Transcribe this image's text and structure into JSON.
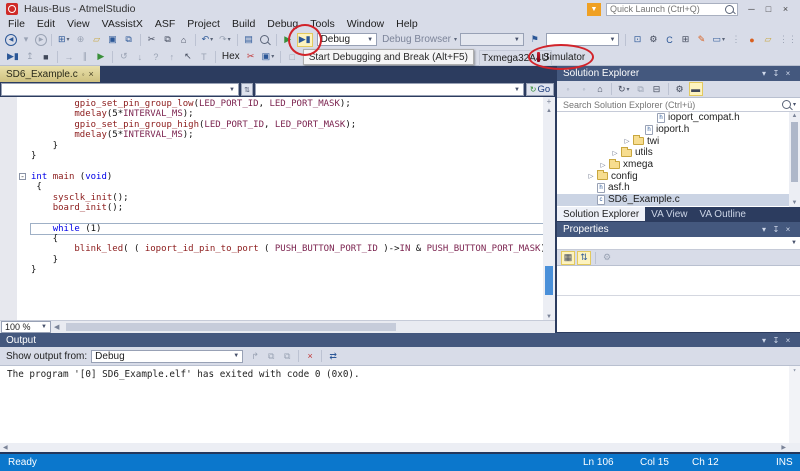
{
  "titlebar": {
    "title": "Haus-Bus - AtmelStudio",
    "quick_launch_placeholder": "Quick Launch (Ctrl+Q)",
    "window_buttons": [
      {
        "n": "minimize-button",
        "g": "─"
      },
      {
        "n": "maximize-button",
        "g": "□"
      },
      {
        "n": "close-button",
        "g": "×"
      }
    ]
  },
  "menubar": {
    "items": [
      "File",
      "Edit",
      "View",
      "VAssistX",
      "ASF",
      "Project",
      "Build",
      "Debug",
      "Tools",
      "Window",
      "Help"
    ]
  },
  "toolbar1": {
    "left_icons": [
      {
        "n": "navigate-backward-icon",
        "g": "◀",
        "c": "blue",
        "circ": true
      },
      {
        "n": "navigate-back-dropdown-icon",
        "g": "▾",
        "c": "dim"
      },
      {
        "n": "navigate-forward-icon",
        "g": "▶",
        "c": "dim",
        "circ": true
      },
      {
        "sep": true
      },
      {
        "n": "new-project-icon",
        "g": "⊞",
        "c": "blue",
        "dd": true
      },
      {
        "n": "add-new-item-icon",
        "g": "⊕",
        "c": "dim"
      },
      {
        "n": "open-file-icon",
        "g": "▱",
        "c": "yellow"
      },
      {
        "n": "save-icon",
        "g": "▣",
        "c": "blue"
      },
      {
        "n": "save-all-icon",
        "g": "⧉",
        "c": "blue"
      },
      {
        "sep": true
      },
      {
        "n": "cut-icon",
        "g": "✂",
        "c": "dark"
      },
      {
        "n": "copy-icon",
        "g": "⧉",
        "c": "dark"
      },
      {
        "n": "paste-icon",
        "g": "⌂",
        "c": "dark"
      },
      {
        "sep": true
      },
      {
        "n": "undo-icon",
        "g": "↶",
        "c": "blue",
        "dd": true
      },
      {
        "n": "redo-icon",
        "g": "↷",
        "c": "dim",
        "dd": true
      },
      {
        "sep": true
      },
      {
        "n": "solution-configurations-icon",
        "g": "▤",
        "c": "blue"
      },
      {
        "n": "find-icon",
        "mag": true
      },
      {
        "sep": true
      },
      {
        "n": "run-icon",
        "g": "▶",
        "c": "green"
      },
      {
        "n": "start-debug-break-icon",
        "g": "▶▮",
        "c": "blue",
        "hl": true
      }
    ],
    "debug_combo": "Debug",
    "debug_browser_label": "Debug Browser",
    "right_icons": [
      {
        "n": "bookmark-flag-icon",
        "g": "⚑",
        "c": "blue"
      }
    ],
    "far_icons": [
      {
        "sep": true
      },
      {
        "n": "switch-windows-icon",
        "g": "⊡",
        "c": "blue"
      },
      {
        "n": "tools-wrench-icon",
        "g": "⚙",
        "c": "dark"
      },
      {
        "n": "refresh-device-icon",
        "g": "C",
        "c": "blue"
      },
      {
        "n": "package-icon",
        "g": "⊞",
        "c": "dark"
      },
      {
        "n": "format-paint-icon",
        "g": "✎",
        "c": "orange"
      },
      {
        "n": "device-programming-icon",
        "g": "▭",
        "c": "blue",
        "dd": true
      },
      {
        "n": "overflow-icon",
        "g": "⋮",
        "c": "dim"
      },
      {
        "n": "asf-wizard-icon",
        "g": "●",
        "c": "orange"
      },
      {
        "n": "import-folder-icon",
        "g": "▱",
        "c": "yellow"
      },
      {
        "n": "overflow2-icon",
        "g": "⋮⋮",
        "c": "dim"
      }
    ]
  },
  "toolbar2": {
    "icons": [
      {
        "n": "restart-debug-icon",
        "g": "▶▮",
        "c": "blue"
      },
      {
        "n": "show-next-statement-icon",
        "g": "↥",
        "c": "dim"
      },
      {
        "n": "stop-debug-icon",
        "g": "■",
        "c": "dark"
      },
      {
        "sep": true
      },
      {
        "n": "step-over-icon",
        "g": "→",
        "c": "dim"
      },
      {
        "n": "break-all-icon",
        "g": "∥",
        "c": "dim"
      },
      {
        "n": "continue-icon",
        "g": "▶",
        "c": "green"
      },
      {
        "sep": true
      },
      {
        "n": "reset-icon",
        "g": "↺",
        "c": "dim"
      },
      {
        "n": "step-into-icon",
        "g": "↓",
        "c": "dim"
      },
      {
        "n": "quick-watch-icon",
        "g": "?",
        "c": "dim"
      },
      {
        "n": "step-out-icon",
        "g": "↑",
        "c": "dim"
      },
      {
        "n": "run-to-cursor-icon",
        "g": "↖",
        "c": "dark"
      },
      {
        "n": "toggle-tool-icon",
        "g": "T",
        "c": "dim"
      },
      {
        "sep": true
      }
    ],
    "hex_label": "Hex",
    "icons2": [
      {
        "n": "delete-breakpoints-icon",
        "g": "✂",
        "c": "red"
      },
      {
        "n": "watch-window-icon",
        "g": "▣",
        "c": "blue",
        "dd": true
      },
      {
        "sep": true
      },
      {
        "n": "disabled-tool-1-icon",
        "g": "□",
        "c": "dim"
      },
      {
        "n": "disabled-tool-2-icon",
        "g": "□",
        "c": "dim"
      }
    ],
    "tooltip": "Start Debugging and Break (Alt+F5)",
    "device_label": "Txmega32A4U",
    "simulator_label": "Simulator"
  },
  "editor": {
    "tab_title": "SD6_Example.c",
    "go_button": "Go",
    "zoom_level": "100 %",
    "code_lines": [
      {
        "segs": [
          [
            "pl",
            "        "
          ],
          [
            "fn",
            "gpio_set_pin_group_low"
          ],
          [
            "pl",
            "("
          ],
          [
            "mc",
            "LED_PORT_ID"
          ],
          [
            "pl",
            ", "
          ],
          [
            "mc",
            "LED_PORT_MASK"
          ],
          [
            "pl",
            ");"
          ]
        ]
      },
      {
        "segs": [
          [
            "pl",
            "        "
          ],
          [
            "fn",
            "mdelay"
          ],
          [
            "pl",
            "(5*"
          ],
          [
            "mc",
            "INTERVAL_MS"
          ],
          [
            "pl",
            ");"
          ]
        ]
      },
      {
        "segs": [
          [
            "pl",
            "        "
          ],
          [
            "fn",
            "gpio_set_pin_group_high"
          ],
          [
            "pl",
            "("
          ],
          [
            "mc",
            "LED_PORT_ID"
          ],
          [
            "pl",
            ", "
          ],
          [
            "mc",
            "LED_PORT_MASK"
          ],
          [
            "pl",
            ");"
          ]
        ]
      },
      {
        "segs": [
          [
            "pl",
            "        "
          ],
          [
            "fn",
            "mdelay"
          ],
          [
            "pl",
            "(5*"
          ],
          [
            "mc",
            "INTERVAL_MS"
          ],
          [
            "pl",
            ");"
          ]
        ]
      },
      {
        "segs": [
          [
            "pl",
            "    }"
          ]
        ]
      },
      {
        "segs": [
          [
            "pl",
            "}"
          ]
        ]
      },
      {
        "segs": []
      },
      {
        "fold": true,
        "segs": [
          [
            "kw",
            "int"
          ],
          [
            "pl",
            " "
          ],
          [
            "fn",
            "main"
          ],
          [
            "pl",
            " ("
          ],
          [
            "kw",
            "void"
          ],
          [
            "pl",
            ")"
          ]
        ]
      },
      {
        "segs": [
          [
            "pl",
            " {"
          ]
        ]
      },
      {
        "segs": [
          [
            "pl",
            "    "
          ],
          [
            "fn",
            "sysclk_init"
          ],
          [
            "pl",
            "();"
          ]
        ]
      },
      {
        "segs": [
          [
            "pl",
            "    "
          ],
          [
            "fn",
            "board_init"
          ],
          [
            "pl",
            "();"
          ]
        ]
      },
      {
        "segs": []
      },
      {
        "current": true,
        "segs": [
          [
            "pl",
            "    "
          ],
          [
            "kw",
            "while"
          ],
          [
            "pl",
            " (1)"
          ]
        ]
      },
      {
        "segs": [
          [
            "pl",
            "    {"
          ]
        ]
      },
      {
        "segs": [
          [
            "pl",
            "        "
          ],
          [
            "fn",
            "blink_led"
          ],
          [
            "pl",
            "( ( "
          ],
          [
            "fn",
            "ioport_id_pin_to_port"
          ],
          [
            "pl",
            " ( "
          ],
          [
            "mc",
            "PUSH_BUTTON_PORT_ID"
          ],
          [
            "pl",
            " )->"
          ],
          [
            "mc",
            "IN"
          ],
          [
            "pl",
            " & "
          ],
          [
            "mc",
            "PUSH_BUTTON_PORT_MASK"
          ],
          [
            "pl",
            ")^"
          ],
          [
            "mc",
            "PUSH_BUTTON_PORT_MASK"
          ],
          [
            "pl",
            " );"
          ]
        ]
      },
      {
        "segs": [
          [
            "pl",
            "    }"
          ]
        ]
      },
      {
        "segs": [
          [
            "pl",
            "}"
          ]
        ]
      }
    ]
  },
  "solution_explorer": {
    "title": "Solution Explorer",
    "search_placeholder": "Search Solution Explorer (Ctrl+ü)",
    "toolbar_icons": [
      {
        "n": "se-back-icon",
        "g": "◦",
        "c": "dim"
      },
      {
        "n": "se-forward-icon",
        "g": "◦",
        "c": "dim"
      },
      {
        "n": "se-home-icon",
        "g": "⌂",
        "c": "dark"
      },
      {
        "sep": true
      },
      {
        "n": "pending-changes-icon",
        "g": "↻",
        "c": "dark",
        "dd": true
      },
      {
        "n": "sync-with-active-document-icon",
        "g": "⧉",
        "c": "dim"
      },
      {
        "n": "collapse-all-icon",
        "g": "⊟",
        "c": "dark"
      },
      {
        "sep": true
      },
      {
        "n": "se-properties-icon",
        "g": "⚙",
        "c": "dark"
      },
      {
        "n": "preview-selected-icon",
        "g": "▬",
        "c": "dark",
        "hl": true
      }
    ],
    "tree": [
      {
        "label": "ioport_compat.h",
        "icon": "header-file",
        "level": 5,
        "expander": false
      },
      {
        "label": "ioport.h",
        "icon": "header-file",
        "level": 4,
        "expander": false
      },
      {
        "label": "twi",
        "icon": "folder",
        "level": 3,
        "expander": true
      },
      {
        "label": "utils",
        "icon": "folder",
        "level": 2,
        "expander": true
      },
      {
        "label": "xmega",
        "icon": "folder",
        "level": 1,
        "expander": true
      },
      {
        "label": "config",
        "icon": "folder",
        "level": 0,
        "expander": true
      },
      {
        "label": "asf.h",
        "icon": "header-file",
        "level": 0,
        "expander": false
      },
      {
        "label": "SD6_Example.c",
        "icon": "c-file",
        "level": 0,
        "expander": false,
        "selected": true
      }
    ],
    "tabs": [
      {
        "label": "Solution Explorer",
        "active": true
      },
      {
        "label": "VA View",
        "active": false
      },
      {
        "label": "VA Outline",
        "active": false
      }
    ]
  },
  "properties": {
    "title": "Properties",
    "toolbar_icons": [
      {
        "n": "categorized-icon",
        "g": "▦",
        "c": "dark",
        "hl": true
      },
      {
        "n": "alphabetical-icon",
        "g": "⇅",
        "c": "blue",
        "hl": true
      },
      {
        "sep": true
      },
      {
        "n": "property-pages-icon",
        "g": "⚙",
        "c": "dim"
      }
    ]
  },
  "output": {
    "title": "Output",
    "show_from_label": "Show output from:",
    "source_value": "Debug",
    "toolbar_icons": [
      {
        "n": "goto-source-icon",
        "g": "↱",
        "c": "dim"
      },
      {
        "n": "prev-message-icon",
        "g": "⧉",
        "c": "dim"
      },
      {
        "n": "next-message-icon",
        "g": "⧉",
        "c": "dim"
      },
      {
        "sep": true
      },
      {
        "n": "clear-all-icon",
        "g": "×",
        "c": "red"
      },
      {
        "sep": true
      },
      {
        "n": "word-wrap-icon",
        "g": "⇄",
        "c": "blue"
      }
    ],
    "lines": [
      "The program '[0] SD6_Example.elf' has exited with code 0 (0x0)."
    ]
  },
  "panel_buttons": [
    {
      "n": "window-position-icon",
      "g": "▾"
    },
    {
      "n": "pin-icon",
      "g": "↧"
    },
    {
      "n": "close-icon",
      "g": "×"
    }
  ],
  "statusbar": {
    "state": "Ready",
    "line": "Ln 106",
    "column": "Col 15",
    "char": "Ch 12",
    "mode": "INS"
  }
}
